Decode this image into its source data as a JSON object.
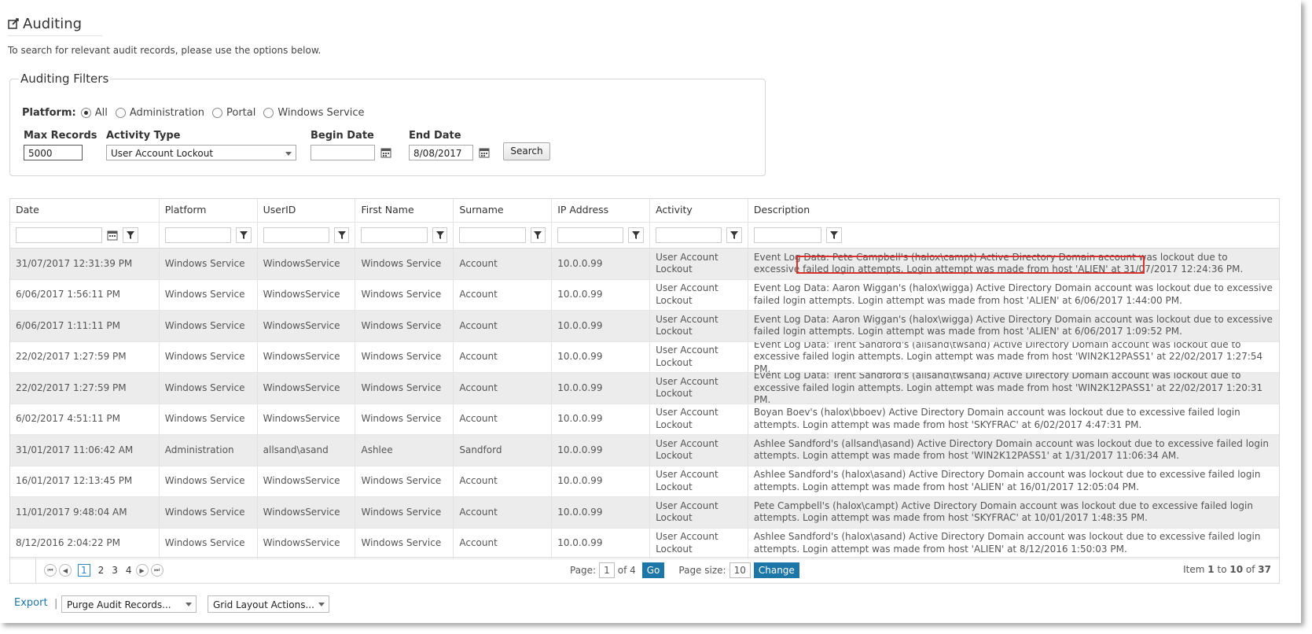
{
  "page": {
    "title": "Auditing",
    "intro": "To search for relevant audit records, please use the options below."
  },
  "filters": {
    "legend": "Auditing Filters",
    "platform_label": "Platform:",
    "platform_options": [
      "All",
      "Administration",
      "Portal",
      "Windows Service"
    ],
    "platform_selected": "All",
    "max_records_label": "Max Records",
    "max_records_value": "5000",
    "activity_type_label": "Activity Type",
    "activity_type_value": "User Account Lockout",
    "begin_date_label": "Begin Date",
    "begin_date_value": "",
    "end_date_label": "End Date",
    "end_date_value": "8/08/2017",
    "search_label": "Search"
  },
  "grid": {
    "columns": [
      "Date",
      "Platform",
      "UserID",
      "First Name",
      "Surname",
      "IP Address",
      "Activity",
      "Description"
    ],
    "rows": [
      [
        "31/07/2017 12:31:39 PM",
        "Windows Service",
        "WindowsService",
        "Windows Service",
        "Account",
        "10.0.0.99",
        "User Account Lockout",
        "Event Log Data: Pete Campbell's (halox\\campt) Active Directory Domain account was lockout due to excessive failed login attempts. Login attempt was made from host 'ALIEN' at 31/07/2017 12:24:36 PM."
      ],
      [
        "6/06/2017 1:56:11 PM",
        "Windows Service",
        "WindowsService",
        "Windows Service",
        "Account",
        "10.0.0.99",
        "User Account Lockout",
        "Event Log Data: Aaron Wiggan's (halox\\wigga) Active Directory Domain account was lockout due to excessive failed login attempts. Login attempt was made from host 'ALIEN' at 6/06/2017 1:44:00 PM."
      ],
      [
        "6/06/2017 1:11:11 PM",
        "Windows Service",
        "WindowsService",
        "Windows Service",
        "Account",
        "10.0.0.99",
        "User Account Lockout",
        "Event Log Data: Aaron Wiggan's (halox\\wigga) Active Directory Domain account was lockout due to excessive failed login attempts. Login attempt was made from host 'ALIEN' at 6/06/2017 1:09:52 PM."
      ],
      [
        "22/02/2017 1:27:59 PM",
        "Windows Service",
        "WindowsService",
        "Windows Service",
        "Account",
        "10.0.0.99",
        "User Account Lockout",
        "Event Log Data: Trent Sandford's (allsand\\twsand) Active Directory Domain account was lockout due to excessive failed login attempts. Login attempt was made from host 'WIN2K12PASS1' at 22/02/2017 1:27:54 PM."
      ],
      [
        "22/02/2017 1:27:59 PM",
        "Windows Service",
        "WindowsService",
        "Windows Service",
        "Account",
        "10.0.0.99",
        "User Account Lockout",
        "Event Log Data: Trent Sandford's (allsand\\twsand) Active Directory Domain account was lockout due to excessive failed login attempts. Login attempt was made from host 'WIN2K12PASS1' at 22/02/2017 1:20:31 PM."
      ],
      [
        "6/02/2017 4:51:11 PM",
        "Windows Service",
        "WindowsService",
        "Windows Service",
        "Account",
        "10.0.0.99",
        "User Account Lockout",
        "Boyan Boev's (halox\\bboev) Active Directory Domain account was lockout due to excessive failed login attempts. Login attempt was made from host 'SKYFRAC' at 6/02/2017 4:47:31 PM."
      ],
      [
        "31/01/2017 11:06:42 AM",
        "Administration",
        "allsand\\asand",
        "Ashlee",
        "Sandford",
        "10.0.0.99",
        "User Account Lockout",
        "Ashlee Sandford's (allsand\\asand) Active Directory Domain account was lockout due to excessive failed login attempts. Login attempt was made from host 'WIN2K12PASS1' at 1/31/2017 11:06:34 AM."
      ],
      [
        "16/01/2017 12:13:45 PM",
        "Windows Service",
        "WindowsService",
        "Windows Service",
        "Account",
        "10.0.0.99",
        "User Account Lockout",
        "Ashlee Sandford's (halox\\asand) Active Directory Domain account was lockout due to excessive failed login attempts. Login attempt was made from host 'ALIEN' at 16/01/2017 12:05:04 PM."
      ],
      [
        "11/01/2017 9:48:04 AM",
        "Windows Service",
        "WindowsService",
        "Windows Service",
        "Account",
        "10.0.0.99",
        "User Account Lockout",
        "Pete Campbell's (halox\\campt) Active Directory Domain account was lockout due to excessive failed login attempts. Login attempt was made from host 'SKYFRAC' at 10/01/2017 1:48:35 PM."
      ],
      [
        "8/12/2016 2:04:22 PM",
        "Windows Service",
        "WindowsService",
        "Windows Service",
        "Account",
        "10.0.0.99",
        "User Account Lockout",
        "Ashlee Sandford's (halox\\asand) Active Directory Domain account was lockout due to excessive failed login attempts. Login attempt was made from host 'ALIEN' at 8/12/2016 1:50:03 PM."
      ]
    ],
    "pager": {
      "pages": [
        "1",
        "2",
        "3",
        "4"
      ],
      "current_page": "1",
      "page_label": "Page:",
      "page_value": "1",
      "of_label": "of 4",
      "go_label": "Go",
      "page_size_label": "Page size:",
      "page_size_value": "10",
      "change_label": "Change",
      "item_label": "Item",
      "item_from": "1",
      "to_label": "to",
      "item_to": "10",
      "of_total_label": "of",
      "item_total": "37"
    }
  },
  "footer": {
    "export_label": "Export",
    "separator": "|",
    "purge_label": "Purge Audit Records...",
    "grid_actions_label": "Grid Layout Actions..."
  },
  "colors": {
    "accent": "#1c76a8",
    "highlight_box": "#d9302c",
    "alt_row": "#ececec"
  }
}
